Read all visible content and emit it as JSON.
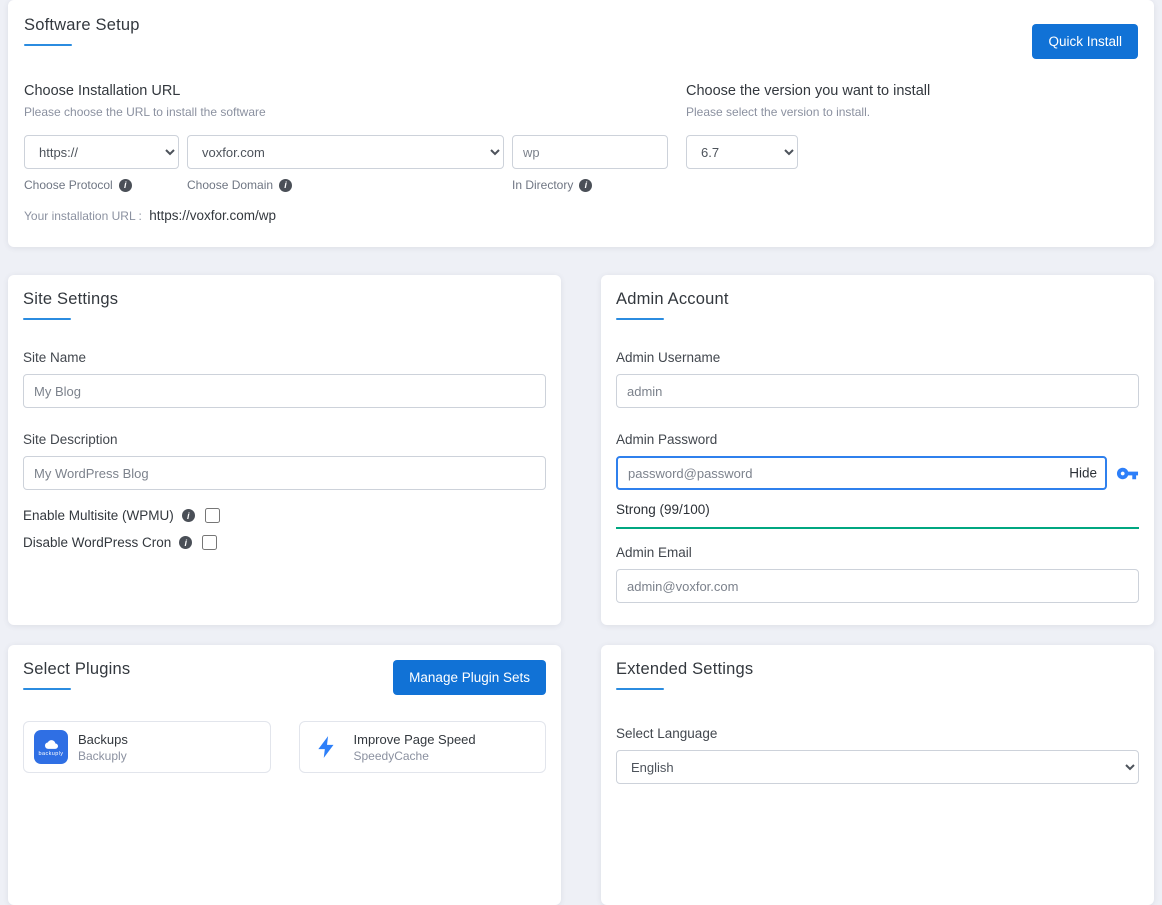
{
  "theme": {
    "accent_blue": "#1172d6",
    "title_underline_blue": "#2b8ce0",
    "focus_border_blue": "#2f80ed",
    "strength_teal": "#00a781",
    "page_background": "#eef0f6"
  },
  "software_setup": {
    "title": "Software Setup",
    "quick_install_label": "Quick Install",
    "install_url": {
      "heading": "Choose Installation URL",
      "subheading": "Please choose the URL to install the software",
      "protocol_value": "https://",
      "protocol_label": "Choose Protocol",
      "domain_value": "voxfor.com",
      "domain_label": "Choose Domain",
      "directory_value": "wp",
      "directory_label": "In Directory",
      "url_prefix": "Your installation URL :",
      "url_value": "https://voxfor.com/wp"
    },
    "version": {
      "heading": "Choose the version you want to install",
      "subheading": "Please select the version to install.",
      "value": "6.7"
    }
  },
  "site_settings": {
    "title": "Site Settings",
    "site_name_label": "Site Name",
    "site_name_value": "My Blog",
    "site_description_label": "Site Description",
    "site_description_value": "My WordPress Blog",
    "multisite_label": "Enable Multisite (WPMU)",
    "multisite_checked": false,
    "cron_label": "Disable WordPress Cron",
    "cron_checked": false
  },
  "admin_account": {
    "title": "Admin Account",
    "username_label": "Admin Username",
    "username_value": "admin",
    "password_label": "Admin Password",
    "password_value": "password@password",
    "hide_label": "Hide",
    "strength_text": "Strong (99/100)",
    "email_label": "Admin Email",
    "email_value": "admin@voxfor.com"
  },
  "select_plugins": {
    "title": "Select Plugins",
    "manage_button_label": "Manage Plugin Sets",
    "plugins": [
      {
        "name": "Backups",
        "vendor": "Backuply",
        "icon_text": "backuply"
      },
      {
        "name": "Improve Page Speed",
        "vendor": "SpeedyCache"
      }
    ]
  },
  "extended_settings": {
    "title": "Extended Settings",
    "language_label": "Select Language",
    "language_value": "English"
  }
}
